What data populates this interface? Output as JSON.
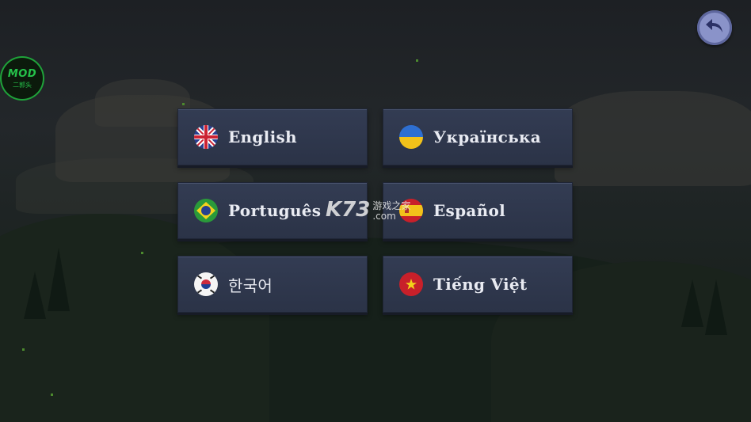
{
  "header": {
    "back_icon": "undo-arrow-icon"
  },
  "badge": {
    "line1": "MOD",
    "line2": "二郭头"
  },
  "languages": [
    {
      "label": "English",
      "flag": "uk-flag-icon"
    },
    {
      "label": "Українська",
      "flag": "ukraine-flag-icon"
    },
    {
      "label": "Português",
      "flag": "brazil-flag-icon"
    },
    {
      "label": "Español",
      "flag": "spain-flag-icon"
    },
    {
      "label": "한국어",
      "flag": "korea-flag-icon"
    },
    {
      "label": "Tiếng Việt",
      "flag": "vietnam-flag-icon"
    }
  ],
  "watermark": {
    "main": "K73",
    "cn": "游戏之家",
    "domain": ".com"
  },
  "colors": {
    "button_bg": "#2f374c",
    "back_button": "#8a93c9",
    "badge_green": "#25c24a"
  }
}
